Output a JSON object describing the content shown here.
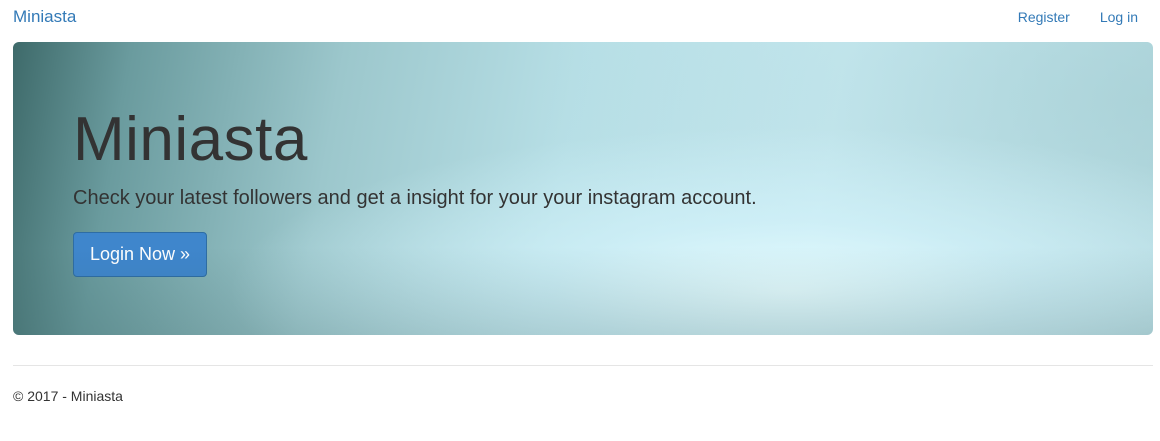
{
  "navbar": {
    "brand": "Miniasta",
    "links": [
      {
        "label": "Register"
      },
      {
        "label": "Log in"
      }
    ]
  },
  "hero": {
    "title": "Miniasta",
    "text": "Check your latest followers and get a insight for your your instagram account.",
    "button_label": "Login Now »"
  },
  "footer": {
    "text": "© 2017 - Miniasta"
  },
  "colors": {
    "link": "#337ab7",
    "button": "#3f86cc",
    "text": "#333333"
  }
}
